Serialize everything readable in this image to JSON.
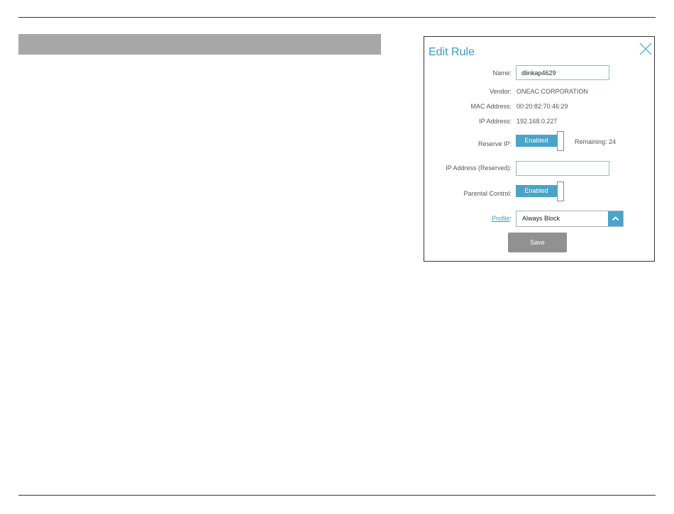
{
  "dialog": {
    "title": "Edit Rule",
    "close_icon": "close-icon"
  },
  "form": {
    "name_label": "Name:",
    "name_value": "dlinkap4629",
    "vendor_label": "Vendor:",
    "vendor_value": "ONEAC CORPORATION",
    "mac_label": "MAC Address:",
    "mac_value": "00:20:82:70:46:29",
    "ip_label": "IP Address:",
    "ip_value": "192.168.0.227",
    "reserve_label": "Reserve IP:",
    "reserve_state": "Enabled",
    "remaining": "Remaining: 24",
    "ip_reserved_label": "IP Address (Reserved):",
    "ip_reserved_value": "",
    "parental_label": "Parental Control:",
    "parental_state": "Enabled",
    "profile_label": "Profile",
    "profile_colon": ":",
    "profile_value": "Always Block",
    "save_label": "Save"
  },
  "colors": {
    "accent": "#3a9cc2",
    "toggle_on": "#4aa3c9",
    "save_button": "#919191",
    "banner": "#a7a7a7"
  }
}
